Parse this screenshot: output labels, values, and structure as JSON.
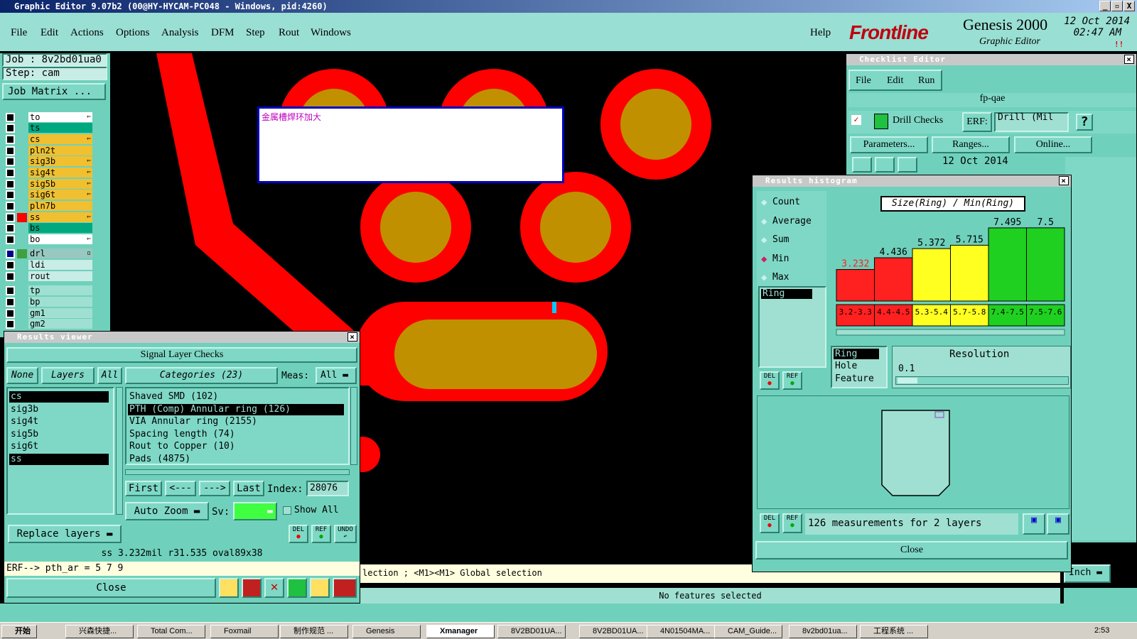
{
  "window": {
    "title": "Graphic Editor 9.07b2 (00@HY-HYCAM-PC048 - Windows, pid:4260)",
    "min": "_",
    "max": "▫",
    "close": "X"
  },
  "menu": {
    "items": [
      "File",
      "Edit",
      "Actions",
      "Options",
      "Analysis",
      "DFM",
      "Step",
      "Rout",
      "Windows"
    ],
    "help": "Help"
  },
  "brand": {
    "logo": "Frontline",
    "product": "Genesis 2000",
    "subtitle": "Graphic Editor",
    "date": "12 Oct 2014",
    "time": "02:47 AM",
    "alert": "!!"
  },
  "job": {
    "job_label": "Job  : 8v2bd01ua0",
    "step_label": "Step: cam",
    "matrix_button": "Job Matrix ..."
  },
  "layers": [
    {
      "name": "to",
      "color": "#ffffff",
      "arrow": "⇐"
    },
    {
      "name": "ts",
      "color": "#00a880",
      "arrow": ""
    },
    {
      "name": "cs",
      "color": "#f0c030",
      "arrow": "⇐"
    },
    {
      "name": "pln2t",
      "color": "#f0c030",
      "arrow": ""
    },
    {
      "name": "sig3b",
      "color": "#f0c030",
      "arrow": "⇐"
    },
    {
      "name": "sig4t",
      "color": "#f0c030",
      "arrow": "⇐"
    },
    {
      "name": "sig5b",
      "color": "#f0c030",
      "arrow": "⇐"
    },
    {
      "name": "sig6t",
      "color": "#f0c030",
      "arrow": "⇐"
    },
    {
      "name": "pln7b",
      "color": "#f0c030",
      "arrow": ""
    },
    {
      "name": "ss",
      "color": "#f0c030",
      "arrow": "⇐"
    },
    {
      "name": "bs",
      "color": "#00a880",
      "arrow": ""
    },
    {
      "name": "bo",
      "color": "#ffffff",
      "arrow": "⇐"
    },
    {
      "name": "drl",
      "color": "#98c8c0",
      "arrow": "▫"
    },
    {
      "name": "ldi",
      "color": "#c8ece6",
      "arrow": ""
    },
    {
      "name": "rout",
      "color": "#c8ece6",
      "arrow": ""
    },
    {
      "name": "tp",
      "color": "#9fe0d2",
      "arrow": ""
    },
    {
      "name": "bp",
      "color": "#9fe0d2",
      "arrow": ""
    },
    {
      "name": "gm1",
      "color": "#9fe0d2",
      "arrow": ""
    },
    {
      "name": "gm2",
      "color": "#9fe0d2",
      "arrow": ""
    }
  ],
  "canvas": {
    "note_text": "金属槽焊环加大",
    "prompt_text": "lection ; <M1><M1> Global selection",
    "status_text": "No features selected",
    "units": "Inch"
  },
  "results_viewer": {
    "title": "Results viewer",
    "header": "Signal Layer Checks",
    "none_btn": "None",
    "layers_btn": "Layers",
    "all_btn": "All",
    "categories_btn": "Categories (23)",
    "meas_label": "Meas:",
    "meas_value": "All",
    "layer_list": [
      "cs",
      "sig3b",
      "sig4t",
      "sig5b",
      "sig6t",
      "ss"
    ],
    "category_list": [
      "Shaved SMD (102)",
      "PTH (Comp) Annular ring (126)",
      "VIA Annular ring (2155)",
      "Spacing length (74)",
      "Rout to Copper (10)",
      "Pads (4875)"
    ],
    "first_btn": "First",
    "prev_btn": "<---",
    "next_btn": "--->",
    "last_btn": "Last",
    "index_label": "Index:",
    "index_value": "28076",
    "autozoom_btn": "Auto Zoom",
    "sv_label": "Sv:",
    "showall_label": "Show All",
    "replace_btn": "Replace layers",
    "del_btn": "DEL",
    "ref_btn": "REF",
    "undo_btn": "UNDO",
    "status_line": "ss 3.232mil  r31.535  oval89x38",
    "erf_line": "ERF--> pth_ar = 5 7 9",
    "close_btn": "Close"
  },
  "checklist": {
    "title": "Checklist Editor",
    "menu": [
      "File",
      "Edit",
      "Run"
    ],
    "name": "fp-qae",
    "check_name": "Drill Checks",
    "erf_label": "ERF:",
    "erf_value": "Drill (Mil",
    "help": "?",
    "params_btn": "Parameters...",
    "ranges_btn": "Ranges...",
    "online_btn": "Online...",
    "date": "12 Oct 2014"
  },
  "histogram": {
    "title": "Results histogram",
    "modes": [
      "Count",
      "Average",
      "Sum",
      "Min",
      "Max"
    ],
    "selected_mode": "Min",
    "chart_title": "Size(Ring) / Min(Ring)",
    "metric_list": [
      "Ring"
    ],
    "resolution_label": "Resolution",
    "resolution_value": "0.1",
    "type_list": [
      "Ring",
      "Hole",
      "Feature"
    ],
    "measurements": "126 measurements for 2 layers",
    "close_btn": "Close",
    "del_btn": "DEL",
    "ref_btn": "REF"
  },
  "chart_data": {
    "type": "bar",
    "title": "Size(Ring) / Min(Ring)",
    "categories": [
      "3.2-3.3",
      "4.4-4.5",
      "5.3-5.4",
      "5.7-5.8",
      "7.4-7.5",
      "7.5-7.6"
    ],
    "values": [
      3.232,
      4.436,
      5.372,
      5.715,
      7.495,
      7.5
    ],
    "value_labels": [
      "3.232",
      "4.436",
      "5.372",
      "5.715",
      "7.495",
      "7.5"
    ],
    "colors": [
      "#ff2020",
      "#ff2020",
      "#ffff20",
      "#ffff20",
      "#20d020",
      "#20d020"
    ],
    "label_colors": [
      "#ff2020",
      "#000000",
      "#000000",
      "#000000",
      "#000000",
      "#000000"
    ],
    "ylim": [
      0,
      8
    ]
  },
  "taskbar": {
    "start": "开始",
    "tasks": [
      "兴森快捷...",
      "Total Com...",
      "Foxmail",
      "制作规范 ...",
      "Genesis",
      "Xmanager",
      "8V2BD01UA...",
      "8V2BD01UA...",
      "4N01504MA...",
      "CAM_Guide...",
      "8v2bd01ua...",
      "工程系统 ..."
    ],
    "clock": "2:53"
  }
}
